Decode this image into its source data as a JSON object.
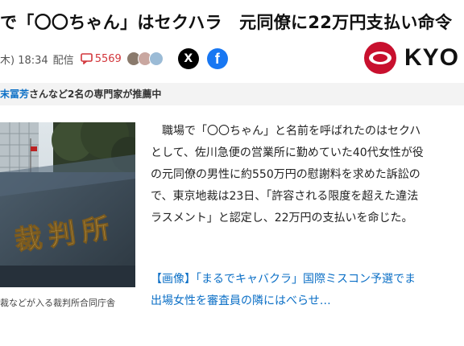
{
  "article": {
    "headline": "で「〇〇ちゃん」はセクハラ　元同僚に22万円支払い命令",
    "date": "木) 18:34",
    "source_label": "配信",
    "comment_count": "5569",
    "share_x": "X",
    "share_fb": "f"
  },
  "publisher": {
    "logo_text": "KYO"
  },
  "recommend": {
    "names": "末冨芳",
    "text": "さんなど2名の専門家が推薦中"
  },
  "photo": {
    "sign_text": "裁判所",
    "caption": "裁などが入る裁判所合同庁舎"
  },
  "body_lines": [
    "　職場で「〇〇ちゃん」と名前を呼ばれたのはセクハ",
    "として、佐川急便の営業所に勤めていた40代女性が役",
    "の元同僚の男性に約550万円の慰謝料を求めた訴訟の",
    "で、東京地裁は23日、「許容される限度を超えた違法",
    "ラスメント」と認定し、22万円の支払いを命じた。"
  ],
  "related_lines": [
    "【画像】「まるでキャバクラ」国際ミスコン予選でま",
    "出場女性を審査員の隣にはべらせ…"
  ],
  "colors": {
    "accent_red": "#d2363b",
    "link_blue": "#0b6fc6",
    "x_black": "#000000",
    "facebook_blue": "#1877f2",
    "logo_red": "#c8102e"
  }
}
